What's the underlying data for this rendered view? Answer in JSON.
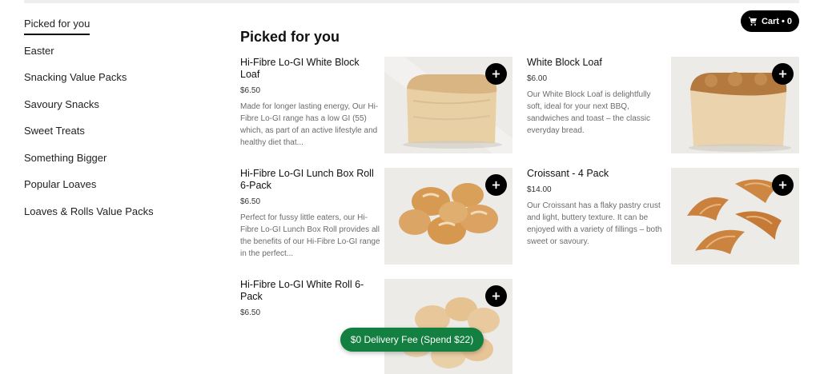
{
  "sidebar": {
    "items": [
      {
        "label": "Picked for you",
        "active": true
      },
      {
        "label": "Easter"
      },
      {
        "label": "Snacking Value Packs"
      },
      {
        "label": "Savoury Snacks"
      },
      {
        "label": "Sweet Treats"
      },
      {
        "label": "Something Bigger"
      },
      {
        "label": "Popular Loaves"
      },
      {
        "label": "Loaves & Rolls Value Packs"
      }
    ]
  },
  "cart": {
    "label": "Cart • 0",
    "icon": "cart-icon"
  },
  "section": {
    "title": "Picked for you"
  },
  "products": [
    {
      "name": "Hi-Fibre Lo-GI White Block Loaf",
      "price": "$6.50",
      "description": "Made for longer lasting energy, Our Hi-Fibre Lo-GI range has a low GI (55) which, as part of an active lifestyle and healthy diet that..."
    },
    {
      "name": "White Block Loaf",
      "price": "$6.00",
      "description": "Our White Block Loaf is delightfully soft, ideal for your next BBQ, sandwiches and toast – the classic everyday bread."
    },
    {
      "name": "Hi-Fibre Lo-GI Lunch Box Roll 6-Pack",
      "price": "$6.50",
      "description": "Perfect for fussy little eaters, our Hi-Fibre Lo-GI Lunch Box Roll provides all the benefits of our Hi-Fibre Lo-GI range in the perfect..."
    },
    {
      "name": "Croissant - 4 Pack",
      "price": "$14.00",
      "description": "Our Croissant has a flaky pastry crust and light, buttery texture. It can be enjoyed with a variety of fillings – both sweet or savoury."
    },
    {
      "name": "Hi-Fibre Lo-GI White Roll 6-Pack",
      "price": "$6.50",
      "description": ""
    }
  ],
  "promo": {
    "label": "$0 Delivery Fee (Spend $22)"
  },
  "colors": {
    "promo": "#138041",
    "button": "#000000",
    "active_underline": "#000000"
  }
}
